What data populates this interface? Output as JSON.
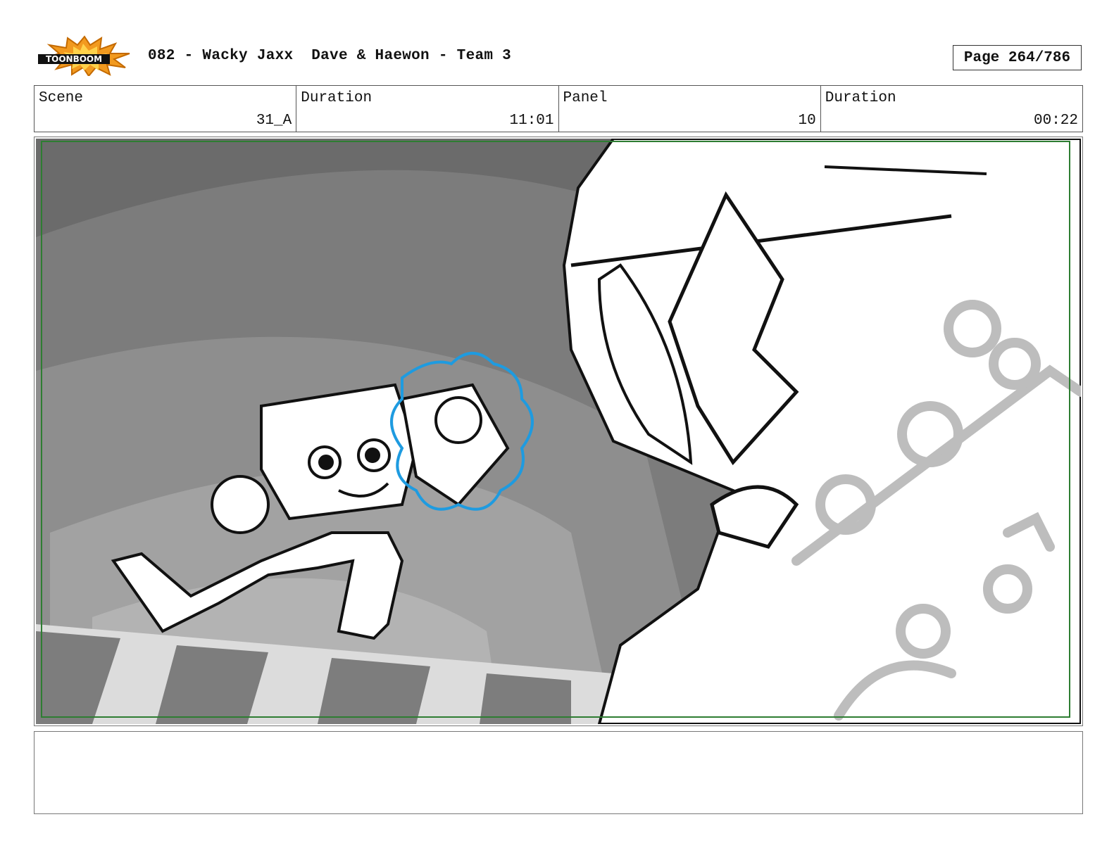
{
  "header": {
    "logo_text": "TOONBOOM",
    "title": "082 - Wacky Jaxx  Dave & Haewon - Team 3",
    "page": "Page 264/786"
  },
  "info": {
    "scene_label": "Scene",
    "scene_value": "31_A",
    "scene_duration_label": "Duration",
    "scene_duration_value": "11:01",
    "panel_label": "Panel",
    "panel_value": "10",
    "panel_duration_label": "Duration",
    "panel_duration_value": "00:22"
  },
  "notes": {
    "text": ""
  },
  "colors": {
    "logo_orange": "#f29a1f",
    "frame_green": "#2e7d32",
    "highlight_blue": "#1e9be0"
  }
}
